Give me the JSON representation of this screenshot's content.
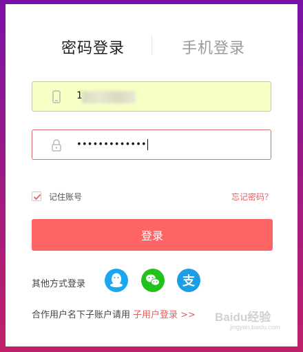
{
  "tabs": {
    "password_login": "密码登录",
    "phone_login": "手机登录"
  },
  "phone": {
    "value": "1"
  },
  "password": {
    "value": "•••••••••••••"
  },
  "remember": {
    "label": "记住账号",
    "checked": true
  },
  "forgot": {
    "label": "忘记密码？"
  },
  "login_button": {
    "label": "登录"
  },
  "other": {
    "label": "其他方式登录"
  },
  "social": {
    "qq": "qq-icon",
    "wechat": "wechat-icon",
    "alipay": "alipay-icon"
  },
  "sub_account": {
    "prefix": "合作用户名下子账户请用",
    "link": "子用户登录 >>"
  },
  "watermark": {
    "text": "Baidu经验",
    "sub": "jingyan.baidu.com"
  },
  "colors": {
    "accent": "#ff6464",
    "link": "#e85b5b",
    "phone_bg": "#f7ffc4"
  }
}
